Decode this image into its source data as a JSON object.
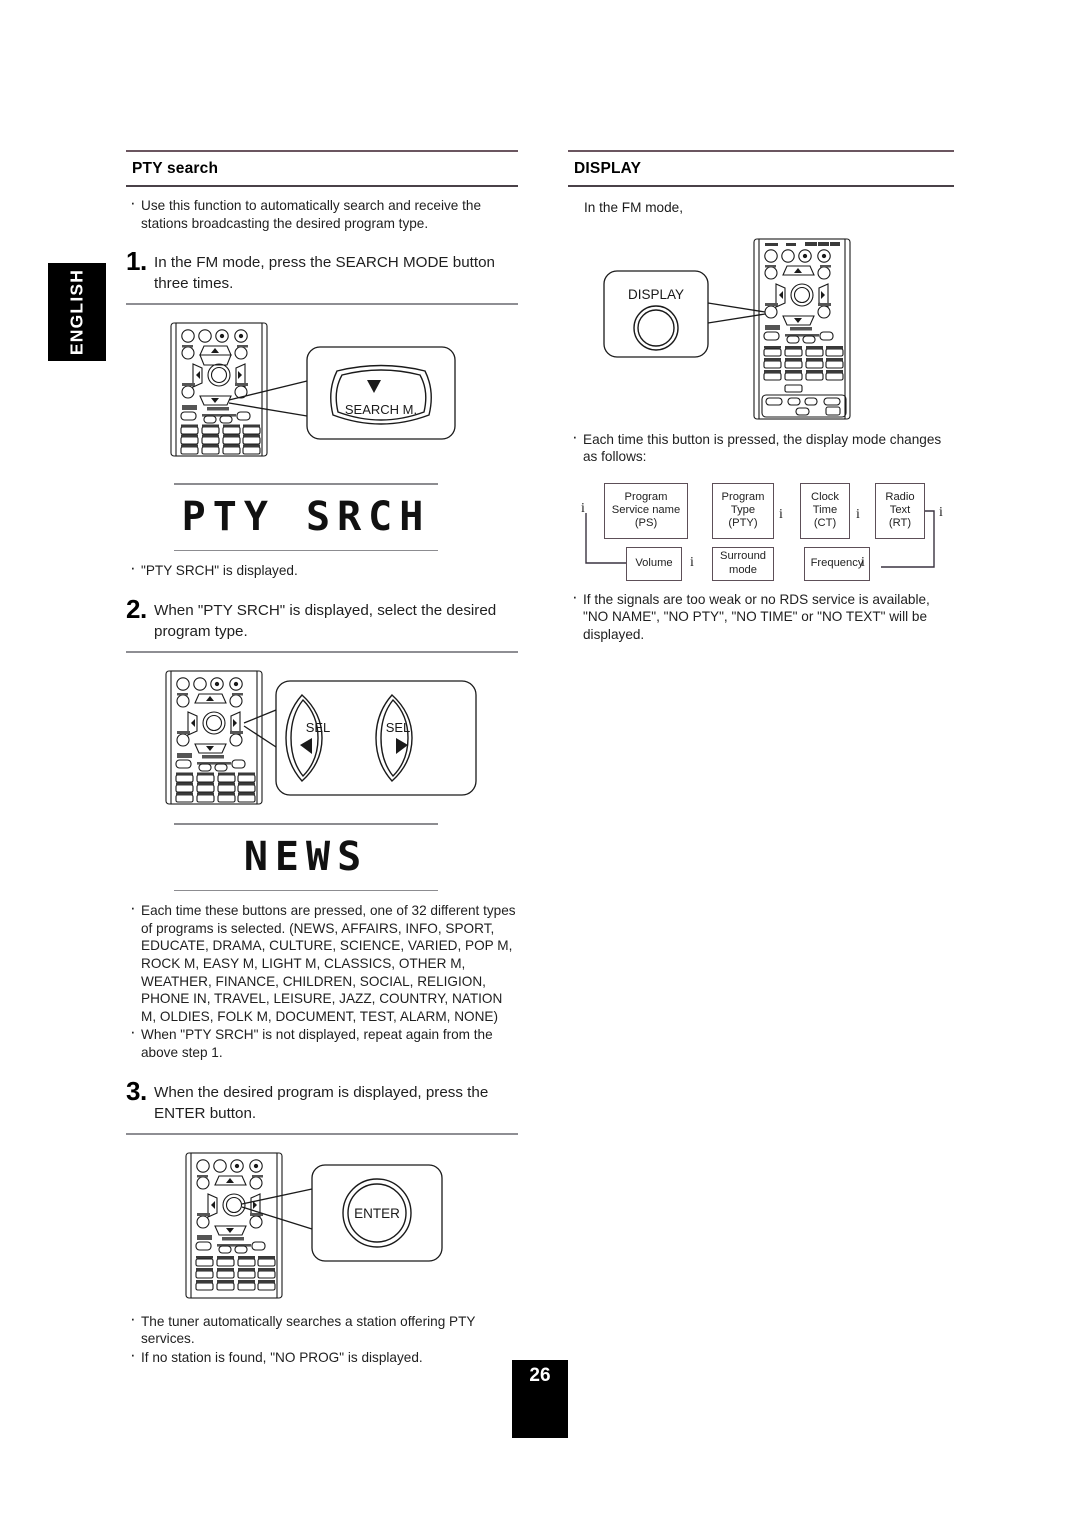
{
  "language_tab": {
    "label": "ENGLISH"
  },
  "page_footer": {
    "number": "26"
  },
  "left_column": {
    "section": {
      "title": "PTY search"
    },
    "intro_bullet": "Use this function to automatically search and receive the stations broadcasting the desired program type.",
    "step1": {
      "number": "1.",
      "text": "In the FM mode, press the SEARCH MODE button three times.",
      "callout_label": "SEARCH M.",
      "callout_icon": "triangle-down-icon"
    },
    "lcd1": {
      "text": "PTY SRCH"
    },
    "lcd1_note": "\"PTY SRCH\" is displayed.",
    "step2": {
      "number": "2.",
      "text": "When \"PTY SRCH\" is displayed, select the desired program type.",
      "callout_left_label": "SEL",
      "callout_left_icon": "triangle-left-icon",
      "callout_right_label": "SEL",
      "callout_right_icon": "triangle-right-icon"
    },
    "lcd2": {
      "text": "NEWS"
    },
    "notes_after_step2": [
      "Each time these buttons are pressed, one of 32 different types of programs is selected. (NEWS, AFFAIRS, INFO, SPORT, EDUCATE, DRAMA,  CULTURE, SCIENCE, VARIED, POP M, ROCK M, EASY M, LIGHT M, CLASSICS, OTHER M, WEATHER, FINANCE, CHILDREN, SOCIAL, RELIGION, PHONE  IN, TRAVEL, LEISURE, JAZZ, COUNTRY, NATION M, OLDIES, FOLK M, DOCUMENT, TEST, ALARM, NONE)",
      "When \"PTY SRCH\" is not displayed, repeat again from the above step 1."
    ],
    "step3": {
      "number": "3.",
      "text": "When the desired program is displayed, press the ENTER button.",
      "callout_label": "ENTER"
    },
    "notes_after_step3": [
      "The tuner automatically searches a station offering PTY services.",
      "If no station is found, \"NO PROG\" is displayed."
    ]
  },
  "right_column": {
    "section": {
      "title": "DISPLAY"
    },
    "intro": "In the FM mode,",
    "callout_label": "DISPLAY",
    "note_before_flow": "Each time this button is pressed, the display mode changes as follows:",
    "flow": {
      "row1": [
        {
          "lines": [
            "Program",
            "Service name",
            "(PS)"
          ]
        },
        {
          "lines": [
            "Program",
            "Type",
            "(PTY)"
          ]
        },
        {
          "lines": [
            "Clock",
            "Time",
            "(CT)"
          ]
        },
        {
          "lines": [
            "Radio",
            "Text",
            "(RT)"
          ]
        }
      ],
      "row2": [
        {
          "lines": [
            "Volume"
          ]
        },
        {
          "lines": [
            "Surround",
            "mode"
          ]
        },
        {
          "lines": [
            "Frequency"
          ]
        }
      ],
      "arrow_glyph": "i"
    },
    "note_after_flow": "If the signals are too weak or no RDS service is available, \"NO NAME\", \"NO PTY\", \"NO TIME\" or \"NO TEXT\" will be displayed."
  },
  "colors": {
    "rule_top": "#6b5660",
    "rule_bottom": "#4a4148",
    "step_rule": "#8e8e93",
    "box_border": "#5d4f58",
    "tab_background": "#000000"
  }
}
